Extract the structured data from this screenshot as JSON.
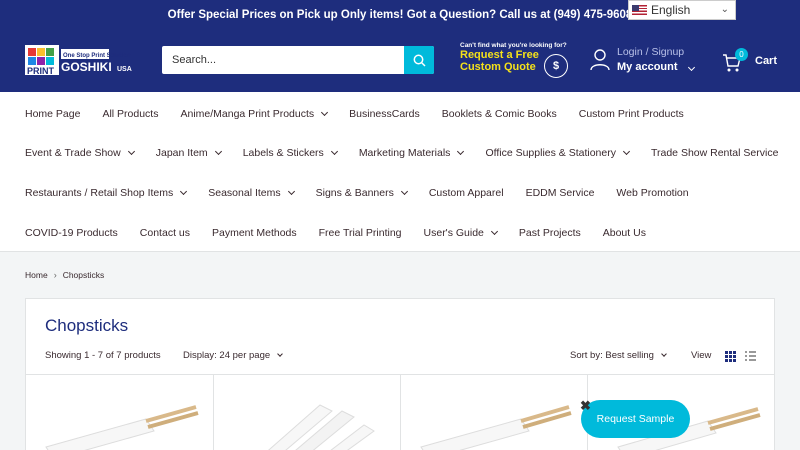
{
  "announcement": {
    "text": "Offer Special Prices on Pick up Only items! Got a Question? Call us at (949) 475-9608"
  },
  "language": {
    "selected": "English"
  },
  "header": {
    "logo": {
      "top_text": "One Stop Print Solution",
      "print": "PRINT",
      "brand": "GOSHIKI",
      "suffix": "USA"
    },
    "search": {
      "placeholder": "Search..."
    },
    "quote": {
      "small": "Can't find what you're looking for?",
      "line1": "Request a Free",
      "line2": "Custom Quote",
      "coin": "$"
    },
    "account": {
      "login": "Login / Signup",
      "my_account": "My account"
    },
    "cart": {
      "count": "0",
      "label": "Cart"
    }
  },
  "nav": {
    "rows": [
      [
        {
          "label": "Home Page",
          "dropdown": false
        },
        {
          "label": "All Products",
          "dropdown": false
        },
        {
          "label": "Anime/Manga Print Products",
          "dropdown": true
        },
        {
          "label": "BusinessCards",
          "dropdown": false
        },
        {
          "label": "Booklets & Comic Books",
          "dropdown": false
        },
        {
          "label": "Custom Print Products",
          "dropdown": false
        }
      ],
      [
        {
          "label": "Event & Trade Show",
          "dropdown": true
        },
        {
          "label": "Japan Item",
          "dropdown": true
        },
        {
          "label": "Labels & Stickers",
          "dropdown": true
        },
        {
          "label": "Marketing Materials",
          "dropdown": true
        },
        {
          "label": "Office Supplies & Stationery",
          "dropdown": true
        },
        {
          "label": "Trade Show Rental Service",
          "dropdown": false
        }
      ],
      [
        {
          "label": "Restaurants / Retail Shop Items",
          "dropdown": true
        },
        {
          "label": "Seasonal Items",
          "dropdown": true
        },
        {
          "label": "Signs & Banners",
          "dropdown": true
        },
        {
          "label": "Custom Apparel",
          "dropdown": false
        },
        {
          "label": "EDDM Service",
          "dropdown": false
        },
        {
          "label": "Web Promotion",
          "dropdown": false
        }
      ],
      [
        {
          "label": "COVID-19 Products",
          "dropdown": false
        },
        {
          "label": "Contact us",
          "dropdown": false
        },
        {
          "label": "Payment Methods",
          "dropdown": false
        },
        {
          "label": "Free Trial Printing",
          "dropdown": false
        },
        {
          "label": "User's Guide",
          "dropdown": true
        },
        {
          "label": "Past Projects",
          "dropdown": false
        },
        {
          "label": "About Us",
          "dropdown": false
        }
      ]
    ]
  },
  "breadcrumb": {
    "home": "Home",
    "current": "Chopsticks"
  },
  "collection": {
    "title": "Chopsticks",
    "showing": "Showing 1 - 7 of 7 products",
    "display": "Display: 24 per page",
    "sort": "Sort by: Best selling",
    "view": "View"
  },
  "floating": {
    "request_sample": "Request Sample",
    "close": "✖"
  },
  "colors": {
    "brand_navy": "#1e2d7d",
    "accent_cyan": "#00badb",
    "quote_yellow": "#f4e11a"
  }
}
